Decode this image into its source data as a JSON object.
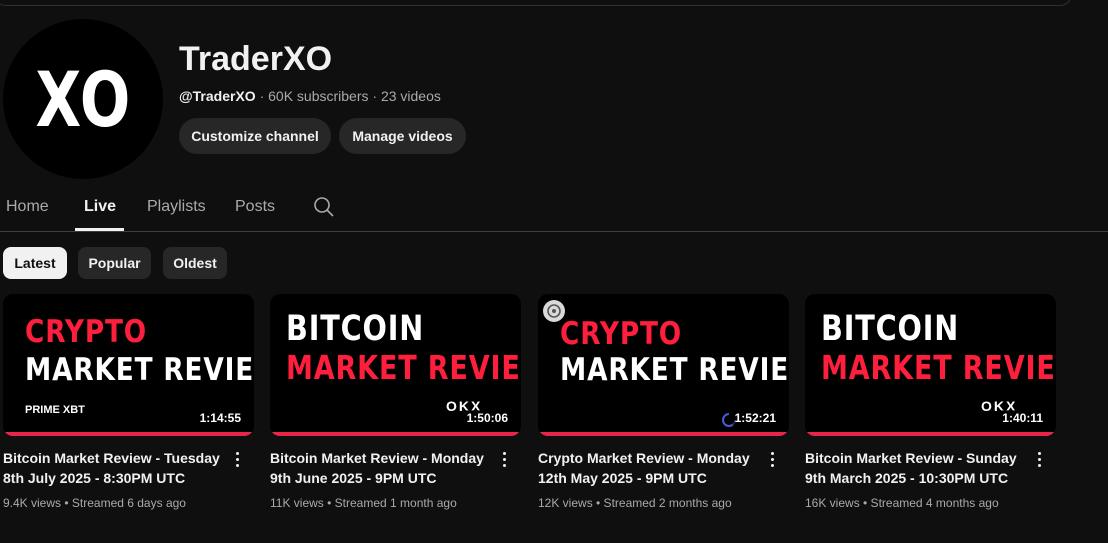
{
  "channel": {
    "avatar_text": "XO",
    "name": "TraderXO",
    "handle": "@TraderXO",
    "meta": " · 60K subscribers · 23 videos"
  },
  "buttons": {
    "customize": "Customize channel",
    "manage": "Manage videos"
  },
  "tabs": [
    {
      "label": "Home"
    },
    {
      "label": "Live"
    },
    {
      "label": "Playlists"
    },
    {
      "label": "Posts"
    }
  ],
  "active_tab": "Live",
  "chips": [
    {
      "label": "Latest"
    },
    {
      "label": "Popular"
    },
    {
      "label": "Oldest"
    }
  ],
  "videos": [
    {
      "thumb_line1": "CRYPTO",
      "thumb_line2": "MARKET REVIEW",
      "sponsor": "PRIME XBT",
      "duration": "1:14:55",
      "title": "Bitcoin Market Review - Tuesday 8th July 2025 - 8:30PM UTC",
      "stats": "9.4K views • Streamed 6 days ago"
    },
    {
      "thumb_line1": "BITCOIN",
      "thumb_line2": "MARKET REVIEW",
      "sponsor": "OKX",
      "duration": "1:50:06",
      "title": "Bitcoin Market Review - Monday 9th June 2025 - 9PM UTC",
      "stats": "11K views • Streamed 1 month ago"
    },
    {
      "thumb_line1": "CRYPTO",
      "thumb_line2": "MARKET REVIEW",
      "sponsor": "",
      "duration": "1:52:21",
      "title": "Crypto Market Review - Monday 12th May 2025 - 9PM UTC",
      "stats": "12K views • Streamed 2 months ago"
    },
    {
      "thumb_line1": "BITCOIN",
      "thumb_line2": "MARKET REVIEW",
      "sponsor": "OKX",
      "duration": "1:40:11",
      "title": "Bitcoin Market Review - Sunday 9th March 2025 - 10:30PM UTC",
      "stats": "16K views • Streamed 4 months ago"
    }
  ],
  "colors": {
    "background": "#0f0f0f",
    "accent_red": "#ff1f3d",
    "progress_red": "#e8264a"
  }
}
